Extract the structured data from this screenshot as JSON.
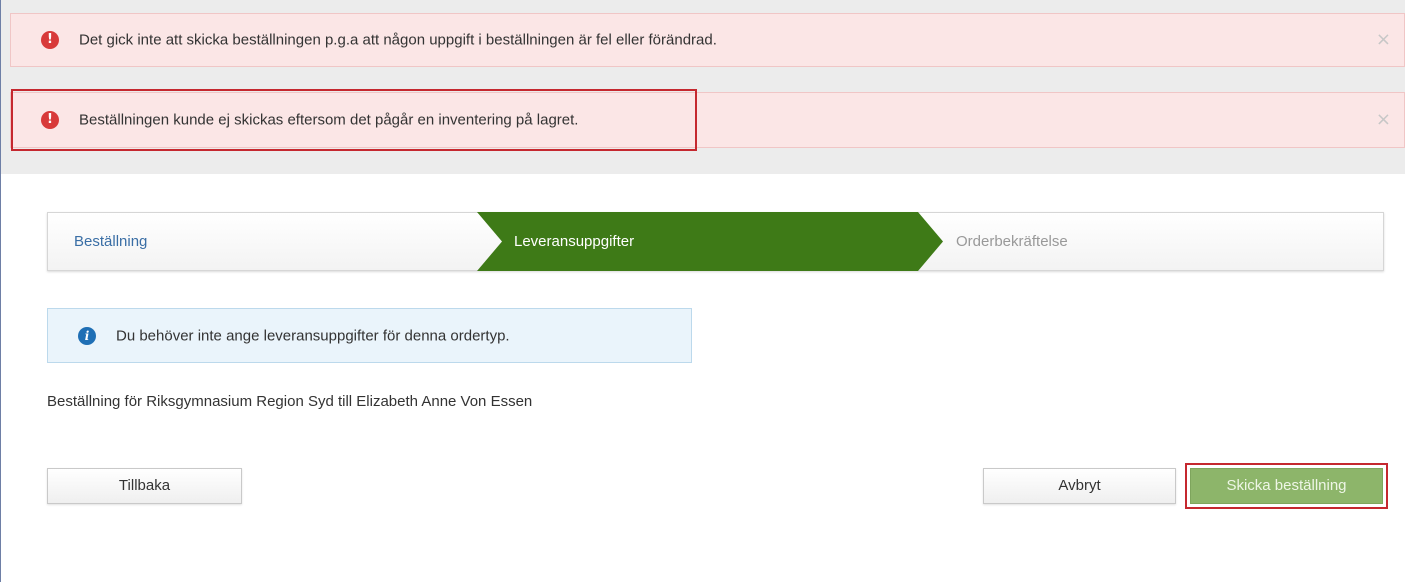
{
  "alerts": [
    {
      "icon": "exclamation-circle-icon",
      "message": "Det gick inte att skicka beställningen p.g.a att någon uppgift i beställningen är fel eller förändrad.",
      "close": "×"
    },
    {
      "icon": "exclamation-circle-icon",
      "message": "Beställningen kunde ej skickas eftersom det pågår en inventering på lagret.",
      "close": "×"
    }
  ],
  "wizard": {
    "steps": [
      {
        "label": "Beställning",
        "state": "completed"
      },
      {
        "label": "Leveransuppgifter",
        "state": "active"
      },
      {
        "label": "Orderbekräftelse",
        "state": "pending"
      }
    ]
  },
  "info": {
    "icon": "info-circle-icon",
    "message": "Du behöver inte ange leveransuppgifter för denna ordertyp."
  },
  "order_description": "Beställning för Riksgymnasium Region Syd till Elizabeth Anne Von Essen",
  "buttons": {
    "back": "Tillbaka",
    "cancel": "Avbryt",
    "send": "Skicka beställning"
  },
  "colors": {
    "error_bg": "#fbe6e6",
    "error_icon": "#d83a3a",
    "active_step": "#3e7a17",
    "info_bg": "#eaf4fb",
    "send_button": "#8db56a",
    "highlight": "#c5282f"
  }
}
